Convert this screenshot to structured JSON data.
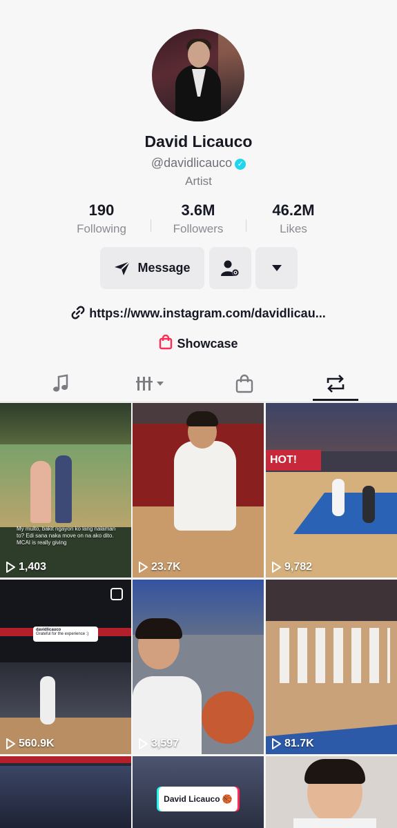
{
  "profile": {
    "name": "David Licauco",
    "handle": "@davidlicauco",
    "bio": "Artist",
    "link": "https://www.instagram.com/davidlicau...",
    "showcase": "Showcase"
  },
  "stats": [
    {
      "value": "190",
      "label": "Following"
    },
    {
      "value": "3.6M",
      "label": "Followers"
    },
    {
      "value": "46.2M",
      "label": "Likes"
    }
  ],
  "actions": {
    "message": "Message",
    "add_friend_icon": "user-settings-icon",
    "more_icon": "caret-down-icon"
  },
  "tabs": [
    {
      "icon": "music-note-icon",
      "selected": false
    },
    {
      "icon": "grid-filter-icon",
      "selected": false
    },
    {
      "icon": "shopping-bag-icon",
      "selected": false
    },
    {
      "icon": "repost-icon",
      "selected": true
    }
  ],
  "videos": [
    {
      "views": "1,403",
      "caption": "My multo, bakit ngayon ko lang nalaman to? Edi sana naka move on na ako dito. MCAI is really giving"
    },
    {
      "views": "23.7K"
    },
    {
      "views": "9,782"
    },
    {
      "views": "560.9K",
      "caption": "Grateful for the experience :)",
      "caption_user": "davidlicauco"
    },
    {
      "views": "3,597"
    },
    {
      "views": "81.7K"
    },
    {
      "views": ""
    },
    {
      "views": "",
      "caption": "David Licauco 🏀"
    },
    {
      "views": ""
    }
  ],
  "colors": {
    "accent_verified": "#20d5ec",
    "showcase_icon": "#fe2c55",
    "text_primary": "#161823",
    "text_secondary": "#8a8b91"
  }
}
